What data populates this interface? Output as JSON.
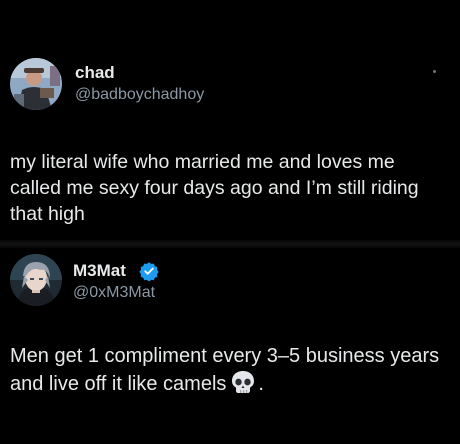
{
  "posts": [
    {
      "name": "chad",
      "handle": "@badboychadhoy",
      "text_lines": [
        "my literal wife who married me and loves me",
        "called me sexy four days ago and I’m still riding",
        "that high"
      ]
    },
    {
      "name": "M3Mat",
      "handle": "@0xM3Mat",
      "verified": true,
      "text_lines": [
        "Men get 1 compliment every 3–5 business years",
        "and live off it like camels"
      ],
      "text_suffix": ".",
      "emoji": "skull-emoji"
    }
  ],
  "colors": {
    "background": "#000000",
    "text": "#e7e9ea",
    "secondary": "#8b98a5",
    "verified": "#1d9bf0"
  }
}
